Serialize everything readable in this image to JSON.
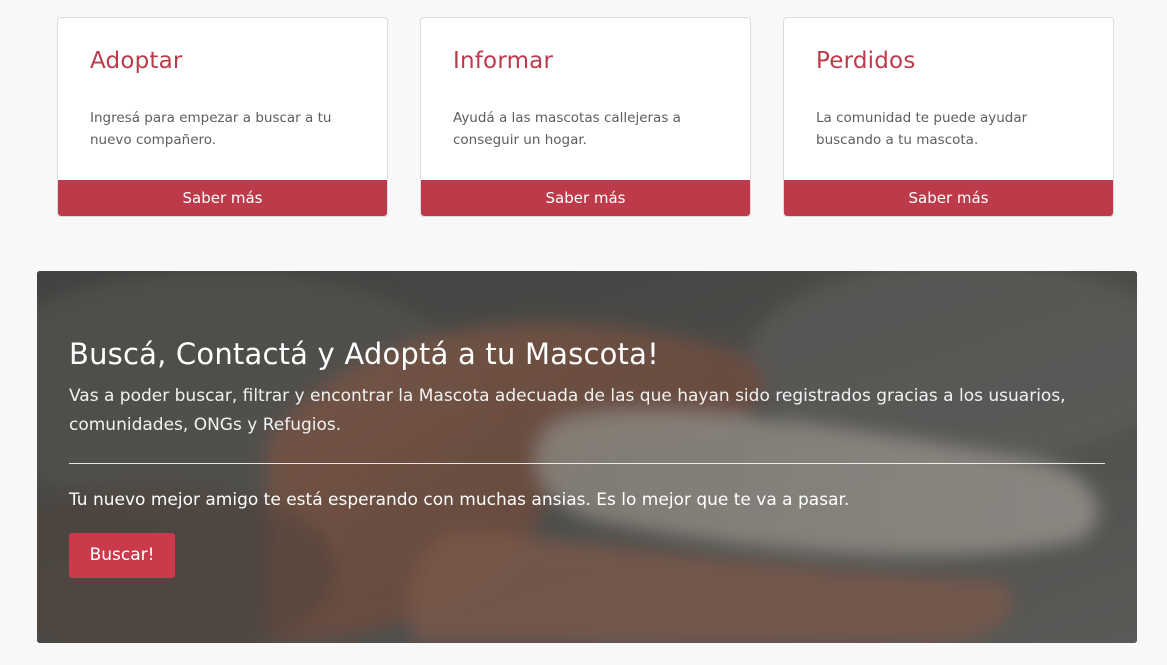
{
  "cards": [
    {
      "title": "Adoptar",
      "text": "Ingresá para empezar a buscar a tu nuevo compañero.",
      "button_label": "Saber más"
    },
    {
      "title": "Informar",
      "text": "Ayudá a las mascotas callejeras a conseguir un hogar.",
      "button_label": "Saber más"
    },
    {
      "title": "Perdidos",
      "text": "La comunidad te puede ayudar buscando a tu mascota.",
      "button_label": "Saber más"
    }
  ],
  "hero": {
    "title": "Buscá, Contactá y Adoptá a tu Mascota!",
    "lead": "Vas a poder buscar, filtrar y encontrar la Mascota adecuada de las que hayan sido registrados gracias a los usuarios, comunidades, ONGs y Refugios.",
    "subtext": "Tu nuevo mejor amigo te está esperando con muchas ansias. Es lo mejor que te va a pasar.",
    "button_label": "Buscar!"
  },
  "colors": {
    "accent": "#bd3a4a",
    "page_background": "#f8f8f8"
  }
}
